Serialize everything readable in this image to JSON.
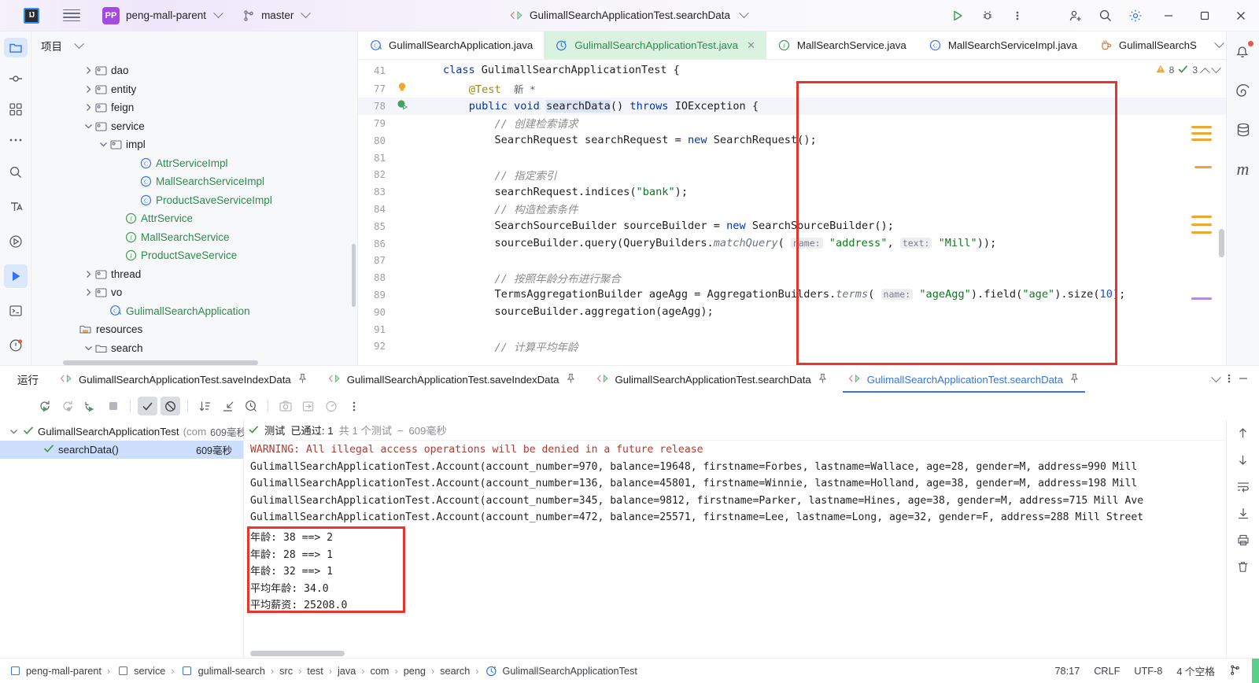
{
  "titlebar": {
    "ide_logo": "intellij-idea-logo",
    "menu_icon": "hamburger-menu-icon",
    "project_badge": "PP",
    "project_name": "peng-mall-parent",
    "branch_icon": "git-branch-icon",
    "branch_name": "master",
    "run_config": "GulimallSearchApplicationTest.searchData",
    "run_icon": "run-button-icon",
    "debug_icon": "debug-button-icon",
    "more_icon": "more-vertical-icon",
    "add_user_icon": "add-user-icon",
    "search_icon": "search-icon",
    "settings_icon": "settings-gear-icon",
    "minimize": "minimize-icon",
    "maximize": "maximize-icon",
    "close": "close-icon"
  },
  "left_rail": {
    "items": [
      {
        "name": "project-tool-icon",
        "glyph": "folder"
      },
      {
        "name": "commit-tool-icon",
        "glyph": "commit"
      },
      {
        "name": "structure-tool-icon",
        "glyph": "grid"
      },
      {
        "name": "more-tool-icon",
        "glyph": "dots"
      }
    ],
    "bottom_items": [
      {
        "name": "find-tool-icon",
        "glyph": "search"
      },
      {
        "name": "translate-tool-icon",
        "glyph": "T"
      },
      {
        "name": "run-tool-icon",
        "glyph": "play-circle"
      },
      {
        "name": "run-window-icon",
        "glyph": "play-filled"
      },
      {
        "name": "terminal-tool-icon",
        "glyph": "terminal"
      },
      {
        "name": "problems-tool-icon",
        "glyph": "problems"
      }
    ]
  },
  "right_rail": {
    "items": [
      {
        "name": "notifications-icon",
        "glyph": "bell",
        "badge": true
      },
      {
        "name": "spring-tool-icon",
        "glyph": "spiral"
      },
      {
        "name": "database-tool-icon",
        "glyph": "database"
      },
      {
        "name": "maven-tool-icon",
        "glyph": "m"
      }
    ]
  },
  "project_panel": {
    "title": "项目",
    "tree": [
      {
        "indent": 3,
        "twist": "right",
        "icon": "folder-src",
        "label": "dao",
        "color": "dark"
      },
      {
        "indent": 3,
        "twist": "right",
        "icon": "folder-src",
        "label": "entity",
        "color": "dark"
      },
      {
        "indent": 3,
        "twist": "right",
        "icon": "folder-src",
        "label": "feign",
        "color": "dark"
      },
      {
        "indent": 3,
        "twist": "down",
        "icon": "folder-src",
        "label": "service",
        "color": "dark"
      },
      {
        "indent": 4,
        "twist": "down",
        "icon": "folder-src",
        "label": "impl",
        "color": "dark"
      },
      {
        "indent": 6,
        "twist": "none",
        "icon": "class-icon",
        "label": "AttrServiceImpl",
        "color": "green"
      },
      {
        "indent": 6,
        "twist": "none",
        "icon": "class-icon",
        "label": "MallSearchServiceImpl",
        "color": "green"
      },
      {
        "indent": 6,
        "twist": "none",
        "icon": "class-icon",
        "label": "ProductSaveServiceImpl",
        "color": "green"
      },
      {
        "indent": 5,
        "twist": "none",
        "icon": "interface-icon",
        "label": "AttrService",
        "color": "green"
      },
      {
        "indent": 5,
        "twist": "none",
        "icon": "interface-icon",
        "label": "MallSearchService",
        "color": "green"
      },
      {
        "indent": 5,
        "twist": "none",
        "icon": "interface-icon",
        "label": "ProductSaveService",
        "color": "green"
      },
      {
        "indent": 3,
        "twist": "right",
        "icon": "folder-src",
        "label": "thread",
        "color": "dark"
      },
      {
        "indent": 3,
        "twist": "right",
        "icon": "folder-src",
        "label": "vo",
        "color": "dark"
      },
      {
        "indent": 4,
        "twist": "none",
        "icon": "spring-class-icon",
        "label": "GulimallSearchApplication",
        "color": "green"
      },
      {
        "indent": 2,
        "twist": "none",
        "icon": "resources-folder-icon",
        "label": "resources",
        "color": "dark"
      },
      {
        "indent": 3,
        "twist": "down",
        "icon": "folder-plain",
        "label": "search",
        "color": "dark"
      }
    ]
  },
  "editor": {
    "tabs": [
      {
        "label": "GulimallSearchApplication.java",
        "icon": "spring-class-icon",
        "active": false,
        "closable": false
      },
      {
        "label": "GulimallSearchApplicationTest.java",
        "icon": "test-class-icon",
        "active": true,
        "closable": true
      },
      {
        "label": "MallSearchService.java",
        "icon": "interface-icon",
        "active": false,
        "closable": false
      },
      {
        "label": "MallSearchServiceImpl.java",
        "icon": "class-icon",
        "active": false,
        "closable": false
      },
      {
        "label": "GulimallSearchS",
        "icon": "java-file-icon",
        "active": false,
        "closable": false
      }
    ],
    "tabs_overflow_icon": "chevron-down-icon",
    "tabs_more_icon": "more-vertical-icon",
    "breadcrumb_line": {
      "number": "41",
      "text": "class GulimallSearchApplicationTest {"
    },
    "inspection": {
      "warnings": "8",
      "checks": "3",
      "up_icon": "chevron-up-icon",
      "down_icon": "chevron-down-icon"
    },
    "lines": [
      {
        "n": "77",
        "gutter": "bulb",
        "segments": [
          {
            "t": "    ",
            "c": "plain"
          },
          {
            "t": "@Test",
            "c": "ann"
          },
          {
            "t": "  ",
            "c": "plain"
          },
          {
            "t": "新 *",
            "c": "hint-label"
          }
        ]
      },
      {
        "n": "78",
        "gutter": "run-test",
        "current": true,
        "segments": [
          {
            "t": "    ",
            "c": "plain"
          },
          {
            "t": "public",
            "c": "kw"
          },
          {
            "t": " ",
            "c": "plain"
          },
          {
            "t": "void",
            "c": "kw"
          },
          {
            "t": " ",
            "c": "plain"
          },
          {
            "t": "searchData",
            "c": "sel"
          },
          {
            "t": "() ",
            "c": "plain"
          },
          {
            "t": "throws",
            "c": "kw"
          },
          {
            "t": " IOException {",
            "c": "plain"
          }
        ]
      },
      {
        "n": "79",
        "gutter": "",
        "segments": [
          {
            "t": "        ",
            "c": "plain"
          },
          {
            "t": "// 创建检索请求",
            "c": "cmt"
          }
        ]
      },
      {
        "n": "80",
        "gutter": "",
        "segments": [
          {
            "t": "        SearchRequest searchRequest = ",
            "c": "plain"
          },
          {
            "t": "new",
            "c": "kw"
          },
          {
            "t": " SearchRequest();",
            "c": "plain"
          }
        ]
      },
      {
        "n": "81",
        "gutter": "",
        "segments": []
      },
      {
        "n": "82",
        "gutter": "",
        "segments": [
          {
            "t": "        ",
            "c": "plain"
          },
          {
            "t": "// 指定索引",
            "c": "cmt"
          }
        ]
      },
      {
        "n": "83",
        "gutter": "",
        "segments": [
          {
            "t": "        searchRequest.indices(",
            "c": "plain"
          },
          {
            "t": "\"bank\"",
            "c": "str"
          },
          {
            "t": ");",
            "c": "plain"
          }
        ]
      },
      {
        "n": "84",
        "gutter": "",
        "segments": [
          {
            "t": "        ",
            "c": "plain"
          },
          {
            "t": "// 构造检索条件",
            "c": "cmt"
          }
        ]
      },
      {
        "n": "85",
        "gutter": "",
        "segments": [
          {
            "t": "        SearchSourceBuilder sourceBuilder = ",
            "c": "plain"
          },
          {
            "t": "new",
            "c": "kw"
          },
          {
            "t": " SearchSourceBuilder();",
            "c": "plain"
          }
        ]
      },
      {
        "n": "86",
        "gutter": "",
        "segments": [
          {
            "t": "        sourceBuilder.query(QueryBuilders.",
            "c": "plain"
          },
          {
            "t": "matchQuery",
            "c": "ital"
          },
          {
            "t": "( ",
            "c": "plain"
          },
          {
            "t": "name:",
            "c": "param"
          },
          {
            "t": " ",
            "c": "plain"
          },
          {
            "t": "\"address\"",
            "c": "str"
          },
          {
            "t": ", ",
            "c": "plain"
          },
          {
            "t": "text:",
            "c": "param"
          },
          {
            "t": " ",
            "c": "plain"
          },
          {
            "t": "\"Mill\"",
            "c": "str"
          },
          {
            "t": "));",
            "c": "plain"
          }
        ]
      },
      {
        "n": "87",
        "gutter": "",
        "segments": []
      },
      {
        "n": "88",
        "gutter": "",
        "segments": [
          {
            "t": "        ",
            "c": "plain"
          },
          {
            "t": "// 按照年龄分布进行聚合",
            "c": "cmt"
          }
        ]
      },
      {
        "n": "89",
        "gutter": "",
        "segments": [
          {
            "t": "        TermsAggregationBuilder ageAgg = AggregationBuilders.",
            "c": "plain"
          },
          {
            "t": "terms",
            "c": "ital"
          },
          {
            "t": "( ",
            "c": "plain"
          },
          {
            "t": "name:",
            "c": "param"
          },
          {
            "t": " ",
            "c": "plain"
          },
          {
            "t": "\"ageAgg\"",
            "c": "str"
          },
          {
            "t": ").field(",
            "c": "plain"
          },
          {
            "t": "\"age\"",
            "c": "str"
          },
          {
            "t": ").size(",
            "c": "plain"
          },
          {
            "t": "10",
            "c": "num"
          },
          {
            "t": ");",
            "c": "plain"
          }
        ]
      },
      {
        "n": "90",
        "gutter": "",
        "segments": [
          {
            "t": "        sourceBuilder.aggregation(ageAgg);",
            "c": "plain"
          }
        ]
      },
      {
        "n": "91",
        "gutter": "",
        "segments": []
      },
      {
        "n": "92",
        "gutter": "",
        "segments": [
          {
            "t": "        ",
            "c": "plain"
          },
          {
            "t": "// 计算平均年龄",
            "c": "cmt"
          }
        ]
      }
    ]
  },
  "run_panel": {
    "title": "运行",
    "tabs": [
      {
        "label": "GulimallSearchApplicationTest.saveIndexData",
        "active": false,
        "pin_icon": "pin-icon"
      },
      {
        "label": "GulimallSearchApplicationTest.saveIndexData",
        "active": false,
        "pin_icon": "pin-icon"
      },
      {
        "label": "GulimallSearchApplicationTest.searchData",
        "active": false,
        "pin_icon": "pin-icon"
      },
      {
        "label": "GulimallSearchApplicationTest.searchData",
        "active": true,
        "pin_icon": "pin-icon"
      }
    ],
    "collapse_icon": "chevron-down-icon",
    "options_icon": "more-vertical-icon",
    "minimize_icon": "minimize-icon",
    "toolbar": [
      {
        "name": "rerun-button",
        "glyph": "rerun",
        "state": "normal"
      },
      {
        "name": "rerun-failed-button",
        "glyph": "rerun-failed",
        "state": "dim"
      },
      {
        "name": "toggle-auto-test-button",
        "glyph": "auto-test",
        "state": "normal"
      },
      {
        "name": "stop-button",
        "glyph": "stop",
        "state": "dim"
      },
      {
        "name": "show-passed-toggle",
        "glyph": "check",
        "state": "on"
      },
      {
        "name": "show-ignored-toggle",
        "glyph": "ignored",
        "state": "on"
      },
      {
        "name": "sort-by-duration-button",
        "glyph": "sort",
        "state": "normal"
      },
      {
        "name": "expand-collapse-button",
        "glyph": "collapse",
        "state": "normal"
      },
      {
        "name": "history-button",
        "glyph": "clock",
        "state": "normal"
      },
      {
        "name": "export-snapshot-button",
        "glyph": "camera",
        "state": "dim"
      },
      {
        "name": "import-tests-button",
        "glyph": "import",
        "state": "dim"
      },
      {
        "name": "open-results-button",
        "glyph": "gauge",
        "state": "dim"
      },
      {
        "name": "more-options-button",
        "glyph": "dots",
        "state": "normal"
      }
    ],
    "test_tree": [
      {
        "indent": 0,
        "twist": "down",
        "status": "passed",
        "label": "GulimallSearchApplicationTest",
        "suffix": "(com",
        "duration": "609毫秒",
        "selected": false
      },
      {
        "indent": 1,
        "twist": "none",
        "status": "passed",
        "label": "searchData()",
        "suffix": "",
        "duration": "609毫秒",
        "selected": true
      }
    ],
    "console_header": {
      "status_icon": "check-icon",
      "label": "测试",
      "result": "已通过: 1",
      "total": "共 1 个测试",
      "dash": "–",
      "duration": "609毫秒"
    },
    "console_lines": [
      {
        "text": "WARNING: All illegal access operations will be denied in a future release",
        "kind": "warn"
      },
      {
        "text": "GulimallSearchApplicationTest.Account(account_number=970, balance=19648, firstname=Forbes, lastname=Wallace, age=28, gender=M, address=990 Mill",
        "kind": "plain"
      },
      {
        "text": "GulimallSearchApplicationTest.Account(account_number=136, balance=45801, firstname=Winnie, lastname=Holland, age=38, gender=M, address=198 Mill",
        "kind": "plain"
      },
      {
        "text": "GulimallSearchApplicationTest.Account(account_number=345, balance=9812, firstname=Parker, lastname=Hines, age=38, gender=M, address=715 Mill Ave",
        "kind": "plain"
      },
      {
        "text": "GulimallSearchApplicationTest.Account(account_number=472, balance=25571, firstname=Lee, lastname=Long, age=32, gender=F, address=288 Mill Street",
        "kind": "plain"
      },
      {
        "text": "年龄: 38 ==> 2",
        "kind": "plain"
      },
      {
        "text": "年龄: 28 ==> 1",
        "kind": "plain"
      },
      {
        "text": "年龄: 32 ==> 1",
        "kind": "plain"
      },
      {
        "text": "平均年龄: 34.0",
        "kind": "plain"
      },
      {
        "text": "平均薪资: 25208.0",
        "kind": "plain"
      }
    ],
    "console_rail": [
      {
        "name": "scroll-up-icon",
        "glyph": "arrow-up"
      },
      {
        "name": "scroll-down-icon",
        "glyph": "arrow-down"
      },
      {
        "name": "soft-wrap-icon",
        "glyph": "wrap"
      },
      {
        "name": "scroll-to-end-icon",
        "glyph": "scroll-end"
      },
      {
        "name": "print-icon",
        "glyph": "printer"
      },
      {
        "name": "clear-all-icon",
        "glyph": "trash"
      }
    ]
  },
  "status_bar": {
    "breadcrumbs": [
      {
        "label": "peng-mall-parent",
        "icon": "module-icon"
      },
      {
        "label": "service",
        "icon": "module-icon"
      },
      {
        "label": "gulimall-search",
        "icon": "module-icon"
      },
      {
        "label": "src",
        "icon": ""
      },
      {
        "label": "test",
        "icon": ""
      },
      {
        "label": "java",
        "icon": ""
      },
      {
        "label": "com",
        "icon": ""
      },
      {
        "label": "peng",
        "icon": ""
      },
      {
        "label": "search",
        "icon": ""
      },
      {
        "label": "GulimallSearchApplicationTest",
        "icon": "test-class-icon"
      }
    ],
    "caret": "78:17",
    "line_sep": "CRLF",
    "encoding": "UTF-8",
    "indent": "4 个空格",
    "branch_icon": "git-branch-icon"
  },
  "colors": {
    "accent_blue": "#3574f0",
    "green": "#2f8a4d",
    "active_tab_bg": "#daf2e0",
    "highlight_red": "#e7352b",
    "purple_badge": "#a44ae0"
  }
}
